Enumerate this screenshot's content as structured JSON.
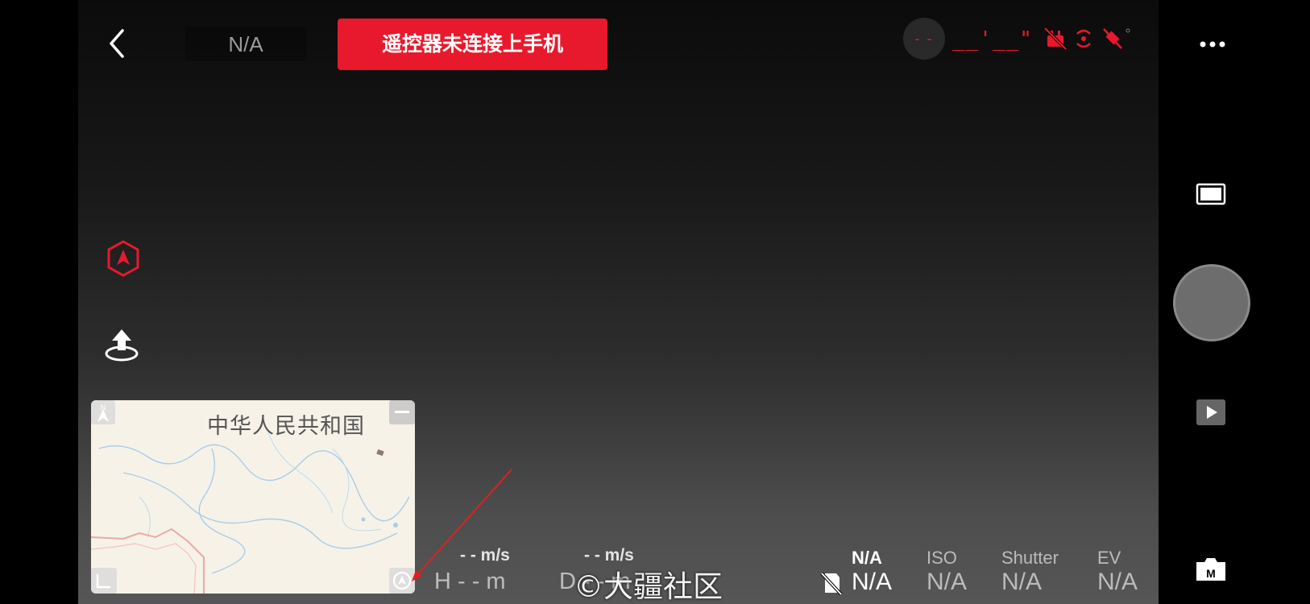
{
  "top_bar": {
    "mode_label": "N/A",
    "alert_text": "遥控器未连接上手机",
    "signal_text": "- -",
    "timer_text": "__'__\""
  },
  "minimap": {
    "country_label": "中华人民共和国",
    "north_label": "N",
    "zoom_out_label": "—"
  },
  "telemetry": {
    "horizontal_speed": "- - m/s",
    "vertical_speed": "- - m/s",
    "height": "H - - m",
    "distance": "D - - m"
  },
  "camera_params": {
    "storage": {
      "label": "N/A",
      "value": "N/A"
    },
    "iso": {
      "label": "ISO",
      "value": "N/A"
    },
    "shutter": {
      "label": "Shutter",
      "value": "N/A"
    },
    "ev": {
      "label": "EV",
      "value": "N/A"
    }
  },
  "right_column": {
    "camera_mode_label": "M"
  },
  "watermark": "©大疆社区",
  "colors": {
    "alert": "#e8192c",
    "warning_icon": "#e8192c",
    "annotation_arrow": "#e02020"
  }
}
